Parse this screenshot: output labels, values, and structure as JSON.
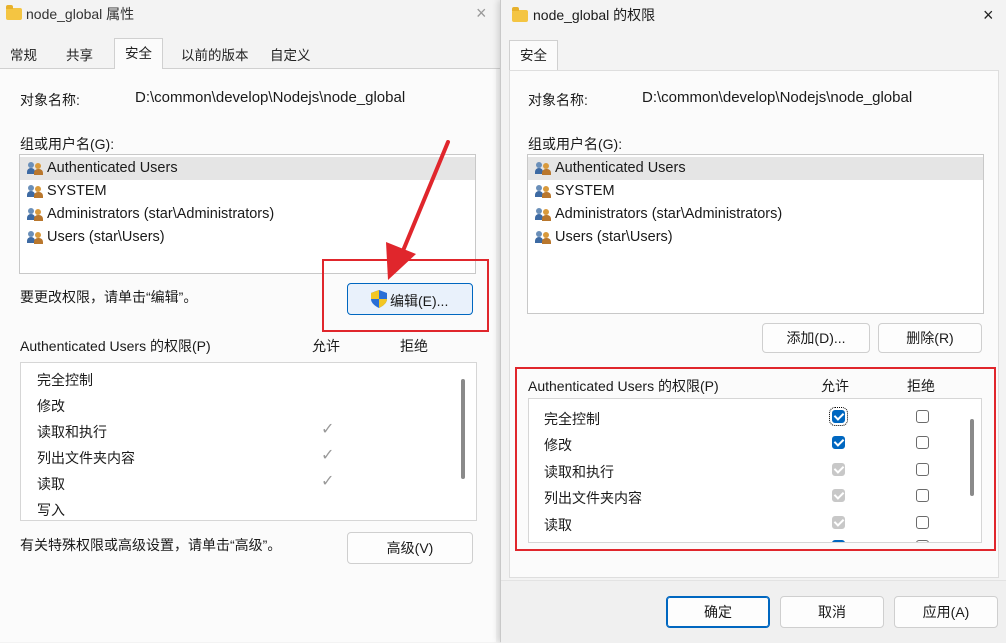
{
  "left": {
    "title": "node_global 属性",
    "tabs": [
      "常规",
      "共享",
      "安全",
      "以前的版本",
      "自定义"
    ],
    "object_label": "对象名称:",
    "object_path": "D:\\common\\develop\\Nodejs\\node_global",
    "group_label": "组或用户名(G):",
    "users": [
      "Authenticated Users",
      "SYSTEM",
      "Administrators (star\\Administrators)",
      "Users (star\\Users)"
    ],
    "edit_hint": "要更改权限，请单击“编辑”。",
    "edit_button": "编辑(E)...",
    "perm_header": "Authenticated Users 的权限(P)",
    "allow": "允许",
    "deny": "拒绝",
    "permissions": [
      "完全控制",
      "修改",
      "读取和执行",
      "列出文件夹内容",
      "读取",
      "写入"
    ],
    "allow_ticks": [
      false,
      false,
      true,
      true,
      true,
      false
    ],
    "advanced_hint": "有关特殊权限或高级设置，请单击“高级”。",
    "advanced_button": "高级(V)",
    "close": "×"
  },
  "right": {
    "title": "node_global 的权限",
    "tab": "安全",
    "object_label": "对象名称:",
    "object_path": "D:\\common\\develop\\Nodejs\\node_global",
    "group_label": "组或用户名(G):",
    "users": [
      "Authenticated Users",
      "SYSTEM",
      "Administrators (star\\Administrators)",
      "Users (star\\Users)"
    ],
    "add_button": "添加(D)...",
    "remove_button": "删除(R)",
    "perm_header": "Authenticated Users 的权限(P)",
    "allow": "允许",
    "deny": "拒绝",
    "permissions": [
      "完全控制",
      "修改",
      "读取和执行",
      "列出文件夹内容",
      "读取"
    ],
    "allow_state": [
      "checked",
      "checked",
      "checked-disabled",
      "checked-disabled",
      "checked-disabled"
    ],
    "deny_state": [
      "unchecked",
      "unchecked",
      "unchecked",
      "unchecked",
      "unchecked"
    ],
    "ok_button": "确定",
    "cancel_button": "取消",
    "apply_button": "应用(A)",
    "close": "×"
  },
  "colors": {
    "accent": "#0067c0",
    "annotation_red": "#e0262c"
  }
}
